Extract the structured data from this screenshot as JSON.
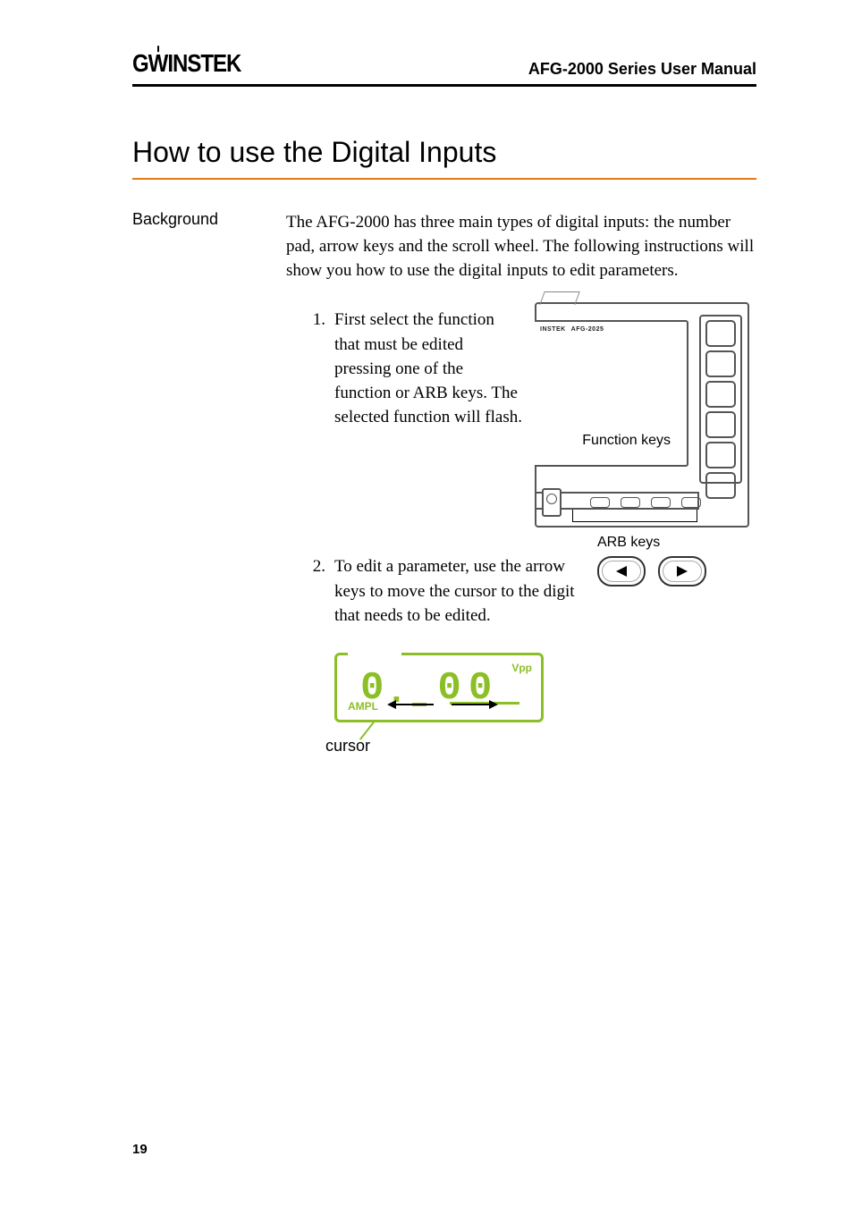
{
  "header": {
    "brand": "GWINSTEK",
    "manual_title": "AFG-2000 Series User Manual"
  },
  "section": {
    "title": "How to use the Digital Inputs"
  },
  "labels": {
    "background": "Background"
  },
  "body": {
    "intro": "The AFG-2000 has three main types of digital inputs: the number pad, arrow keys and the scroll wheel.  The following instructions will show you how to use the digital inputs to edit parameters.",
    "step1_num": "1.",
    "step1": "First select the function that must be edited pressing one of the function or ARB keys. The selected function will flash.",
    "step2_num": "2.",
    "step2": "To edit a parameter, use the arrow keys to move the cursor to the digit that needs to be edited."
  },
  "figure1": {
    "device_model": "AFG-2025",
    "device_brand": "INSTEK",
    "function_keys_label": "Function keys",
    "arb_keys_label": "ARB keys"
  },
  "figure2": {
    "left_arrow_icon": "left-arrow-icon",
    "right_arrow_icon": "right-arrow-icon"
  },
  "figure3": {
    "display_value": "0.  0 0",
    "unit": "Vpp",
    "row_label": "AMPL",
    "cursor_label": "cursor"
  },
  "page_number": "19"
}
